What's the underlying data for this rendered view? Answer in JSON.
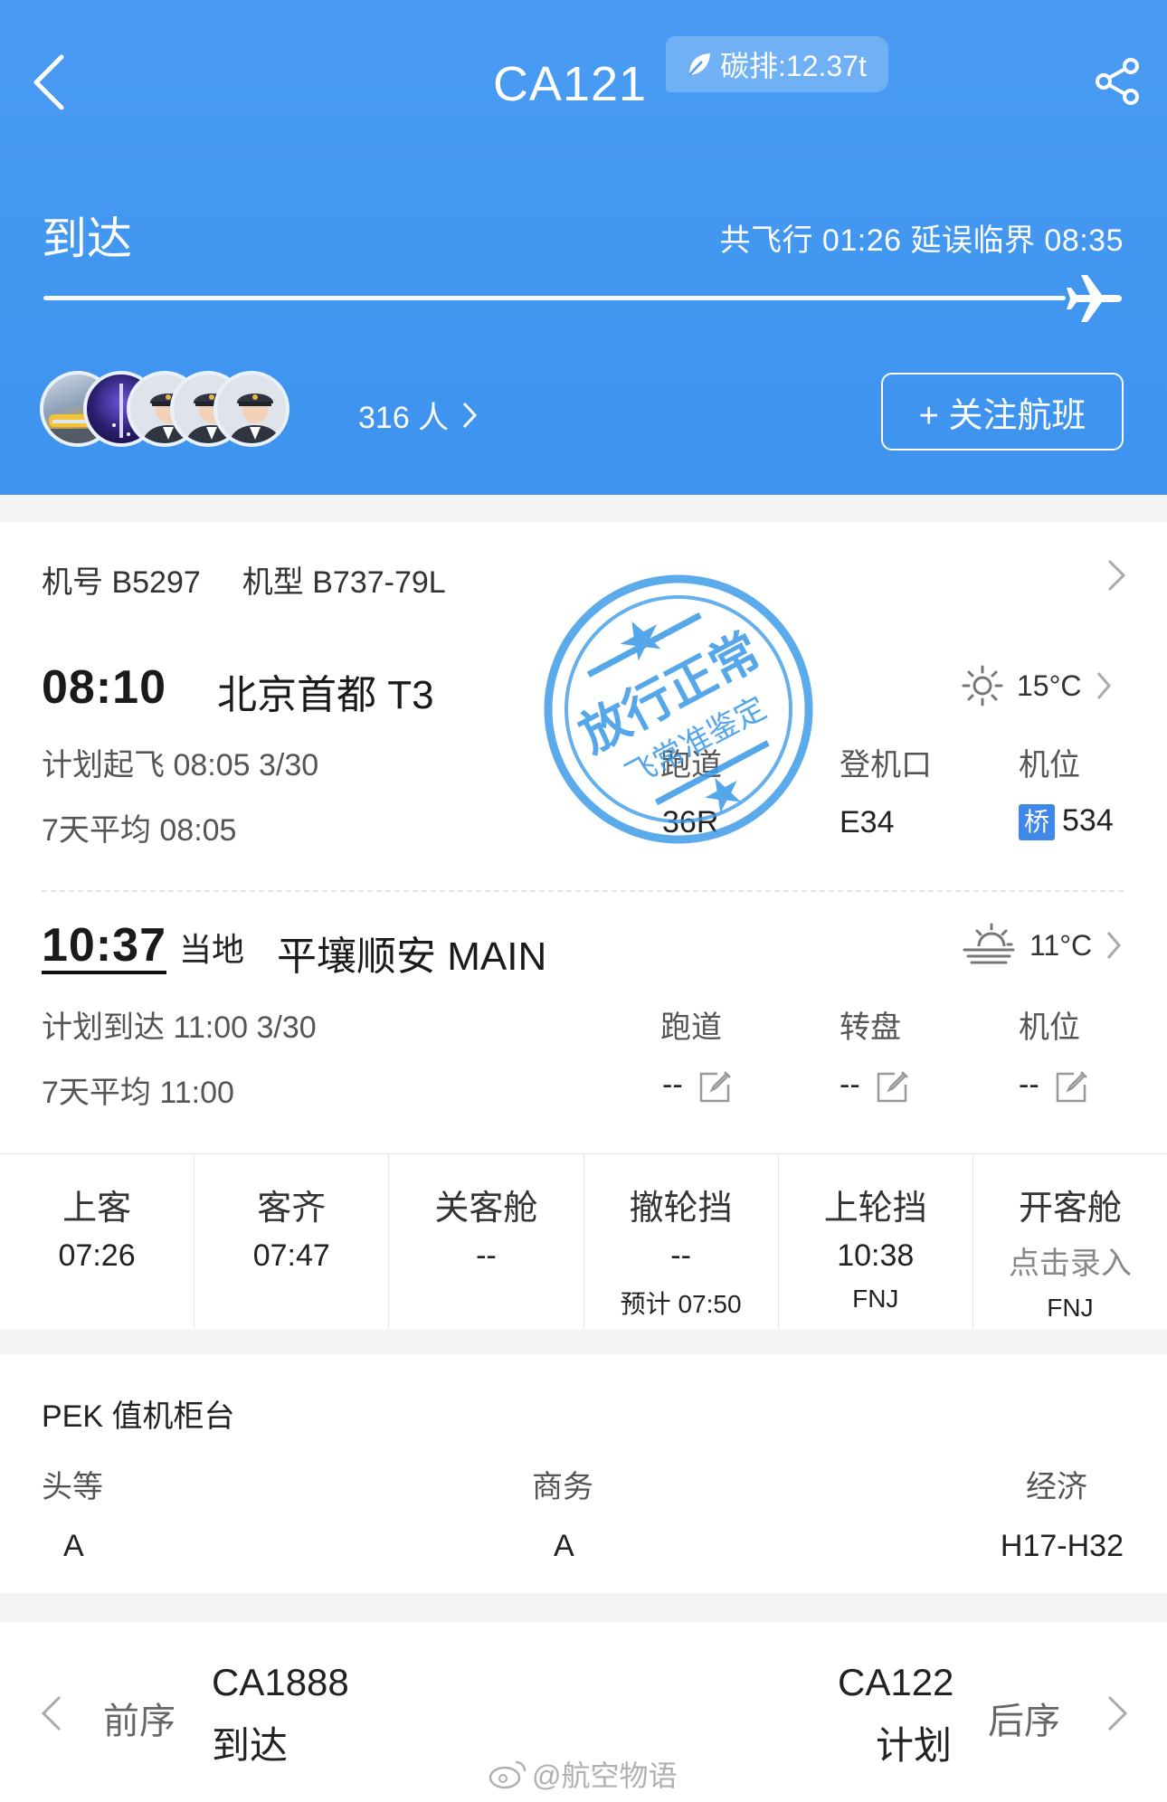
{
  "header": {
    "flight_no": "CA121",
    "carbon_badge": "碳排:12.37t",
    "status": "到达",
    "flight_summary": "共飞行 01:26 延误临界 08:35",
    "followers_count": "316 人",
    "follow_button": "+ 关注航班",
    "icons": [
      "back-arrow-icon",
      "leaf-icon",
      "share-icon",
      "plane-icon",
      "chevron-right-icon",
      "plus-icon"
    ],
    "colors": {
      "header_bg": "#4196f0",
      "accent": "#3f87e8"
    }
  },
  "aircraft": {
    "reg_label": "机号",
    "reg": "B5297",
    "type_label": "机型",
    "type": "B737-79L"
  },
  "departure": {
    "time": "08:10",
    "airport": "北京首都 T3",
    "temperature": "15°C",
    "weather_icon": "sunny-icon",
    "scheduled_label": "计划起飞",
    "scheduled": "08:05 3/30",
    "avg_label": "7天平均",
    "avg": "08:05",
    "columns": [
      {
        "label": "跑道",
        "value": "36R"
      },
      {
        "label": "登机口",
        "value": "E34"
      },
      {
        "label": "机位",
        "badge": "桥",
        "value": "534"
      }
    ]
  },
  "arrival": {
    "time": "10:37",
    "local_label": "当地",
    "airport": "平壤顺安 MAIN",
    "temperature": "11°C",
    "weather_icon": "haze-sun-icon",
    "scheduled_label": "计划到达",
    "scheduled": "11:00 3/30",
    "avg_label": "7天平均",
    "avg": "11:00",
    "columns": [
      {
        "label": "跑道",
        "value": "--"
      },
      {
        "label": "转盘",
        "value": "--"
      },
      {
        "label": "机位",
        "value": "--"
      }
    ]
  },
  "stamp": {
    "main_text": "放行正常",
    "sub_text": "飞常准鉴定"
  },
  "milestones": [
    {
      "title": "上客",
      "value": "07:26",
      "sub": ""
    },
    {
      "title": "客齐",
      "value": "07:47",
      "sub": ""
    },
    {
      "title": "关客舱",
      "value": "--",
      "sub": ""
    },
    {
      "title": "撤轮挡",
      "value": "--",
      "sub": "预计 07:50"
    },
    {
      "title": "上轮挡",
      "value": "10:38",
      "sub": "FNJ"
    },
    {
      "title": "开客舱",
      "value": "点击录入",
      "sub": "FNJ"
    }
  ],
  "checkin": {
    "title": "PEK 值机柜台",
    "classes": [
      {
        "label": "头等",
        "value": "A"
      },
      {
        "label": "商务",
        "value": "A"
      },
      {
        "label": "经济",
        "value": "H17-H32"
      }
    ]
  },
  "nav": {
    "prev_label": "前序",
    "prev_flight": "CA1888",
    "prev_status": "到达",
    "next_label": "后序",
    "next_flight": "CA122",
    "next_status": "计划"
  },
  "watermark": "@航空物语"
}
